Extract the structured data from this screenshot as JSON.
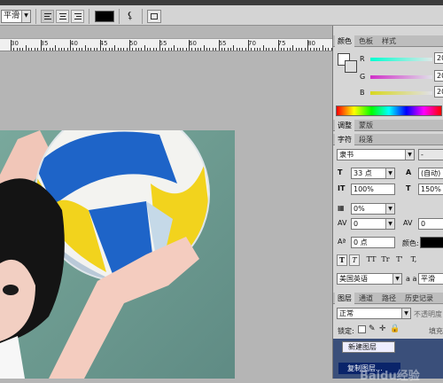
{
  "optionbar": {
    "antialias_value": "平滑",
    "text_color": "#000000"
  },
  "ruler": {
    "labels": [
      "30",
      "35",
      "40",
      "45",
      "50",
      "55",
      "60",
      "65",
      "70",
      "75",
      "80"
    ]
  },
  "panels": {
    "color": {
      "tabs": [
        "颜色",
        "色板",
        "样式"
      ],
      "channels": [
        {
          "label": "R",
          "value": "20"
        },
        {
          "label": "G",
          "value": "20"
        },
        {
          "label": "B",
          "value": "20"
        }
      ]
    },
    "adjust": {
      "tabs": [
        "调整",
        "蒙版"
      ]
    },
    "character": {
      "tabs": [
        "字符",
        "段落"
      ],
      "font": "隶书",
      "style": "-",
      "size": "33 点",
      "leading": "(自动)",
      "vscale": "100%",
      "hscale": "150%",
      "tracking_pct": "0%",
      "kerning": "0",
      "tracking": "0",
      "baseline": "0 点",
      "color_label": "颜色:",
      "language": "美国英语",
      "aa_label": "a a",
      "aa_value": "平滑",
      "type_styles": [
        "T",
        "T",
        "TT",
        "Tr",
        "T'",
        "T,"
      ]
    },
    "layers": {
      "tabs": [
        "图层",
        "通道",
        "路径",
        "历史记录"
      ],
      "blend": "正常",
      "opacity_label": "不透明度",
      "lock_label": "锁定:",
      "fill_label": "填充",
      "tooltip_title": "新建图层",
      "tooltip_item": "复制图层..."
    }
  },
  "watermark": "Baidu经验"
}
